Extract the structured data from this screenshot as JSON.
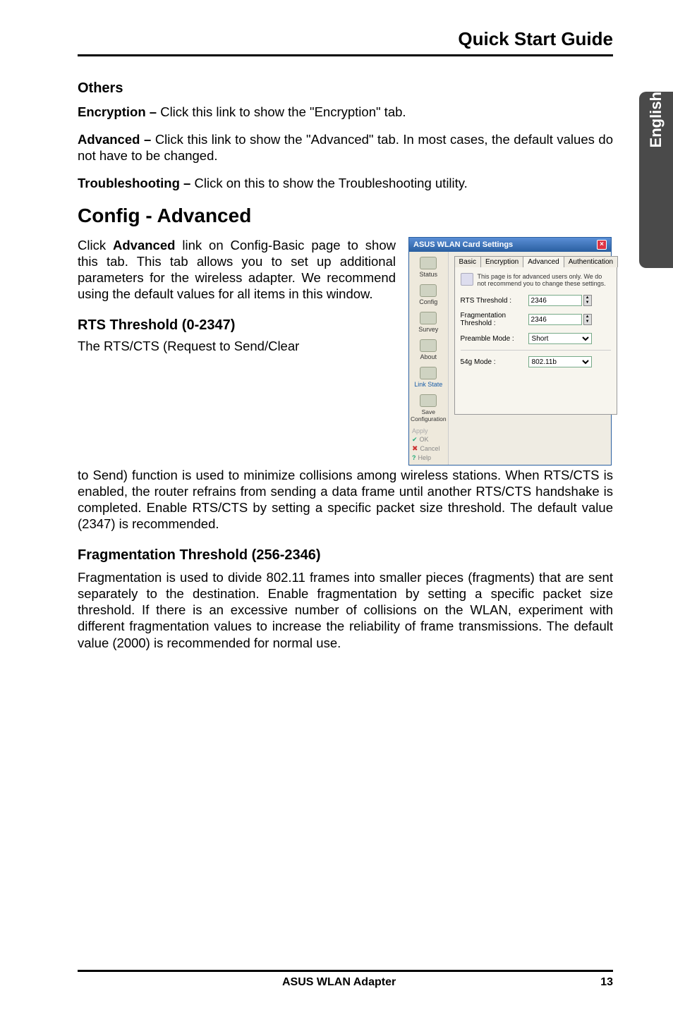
{
  "header": {
    "title": "Quick Start Guide",
    "side_label": "English"
  },
  "others": {
    "heading": "Others",
    "enc_label": "Encryption – ",
    "enc_text": "Click this link to show the \"Encryption\" tab.",
    "adv_label": "Advanced – ",
    "adv_text": "Click this link to show the \"Advanced\" tab. In most cases, the default values do not have to be changed.",
    "trb_label": "Troubleshooting – ",
    "trb_text": "Click on this to show the Troubleshooting utility."
  },
  "config": {
    "heading": "Config - Advanced",
    "intro_a": "Click ",
    "intro_b": "Advanced",
    "intro_c": " link on Config-Basic page to show this tab. This tab allows you to set up additional parameters for the wireless adapter. We recommend using the default values for all items in this window.",
    "rts_heading": "RTS Threshold (0-2347)",
    "rts_lead": "The RTS/CTS (Request to Send/Clear",
    "rts_rest": "to Send) function is used to minimize collisions among wireless stations. When RTS/CTS is enabled, the router refrains from sending a data frame until another RTS/CTS handshake is completed. Enable RTS/CTS by setting a specific packet size threshold. The default value (2347) is recommended.",
    "frag_heading": "Fragmentation Threshold (256-2346)",
    "frag_text": "Fragmentation is used to divide 802.11 frames into smaller pieces (fragments) that are sent separately to the destination. Enable fragmentation by setting a specific packet size threshold. If there is an excessive number of collisions on the WLAN, experiment with different fragmentation values to increase the reliability of frame transmissions. The default value (2000) is recommended for normal use."
  },
  "dialog": {
    "title": "ASUS WLAN Card Settings",
    "tabs": {
      "basic": "Basic",
      "encryption": "Encryption",
      "advanced": "Advanced",
      "auth": "Authentication"
    },
    "hint": "This page is for advanced users only. We do not recommend you to change these settings.",
    "fields": {
      "rts_label": "RTS Threshold :",
      "rts_value": "2346",
      "frag_label": "Fragmentation Threshold :",
      "frag_value": "2346",
      "preamble_label": "Preamble Mode :",
      "preamble_value": "Short",
      "mode_label": "54g Mode :",
      "mode_value": "802.11b"
    },
    "side": {
      "status": "Status",
      "config": "Config",
      "survey": "Survey",
      "about": "About",
      "linkstate": "Link State",
      "save": "Save Configuration",
      "apply": "Apply",
      "ok": "OK",
      "cancel": "Cancel",
      "help": "Help"
    }
  },
  "footer": {
    "center": "ASUS WLAN Adapter",
    "page": "13"
  }
}
